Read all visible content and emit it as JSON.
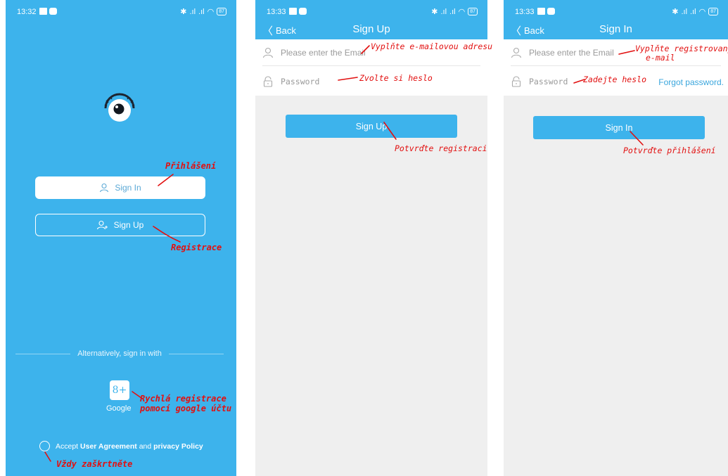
{
  "colors": {
    "primary": "#3db3ec",
    "annotation": "#e21010",
    "panel_bg": "#efefef"
  },
  "screen1": {
    "status_time": "13:32",
    "battery": "87",
    "sign_in_label": "Sign In",
    "sign_up_label": "Sign Up",
    "alt_text": "Alternatively, sign in with",
    "google_icon_text": "8+",
    "google_label": "Google",
    "agree_prefix": "Accept",
    "agree_link1": "User Agreement",
    "agree_mid": "and",
    "agree_link2": "privacy Policy",
    "annotations": {
      "sign_in": "Přihlášení",
      "sign_up": "Registrace",
      "google_line1": "Rychlá registrace",
      "google_line2": "pomocí google účtu",
      "agree": "Vždy zaškrtněte"
    }
  },
  "screen2": {
    "status_time": "13:33",
    "battery": "87",
    "back_label": "Back",
    "title": "Sign Up",
    "email_placeholder": "Please enter the Email",
    "password_placeholder": "Password",
    "submit_label": "Sign Up",
    "annotations": {
      "email": "Vyplňte e-mailovou adresu",
      "password": "Zvolte si heslo",
      "submit": "Potvrďte registraci"
    }
  },
  "screen3": {
    "status_time": "13:33",
    "battery": "87",
    "back_label": "Back",
    "title": "Sign In",
    "email_placeholder": "Please enter the Email",
    "password_placeholder": "Password",
    "forgot_label": "Forgot password.",
    "submit_label": "Sign In",
    "annotations": {
      "email_line1": "Vyplňte registrovaný",
      "email_line2": "e-mail",
      "password": "Zadejte heslo",
      "submit": "Potvrďte přihlášení"
    }
  }
}
